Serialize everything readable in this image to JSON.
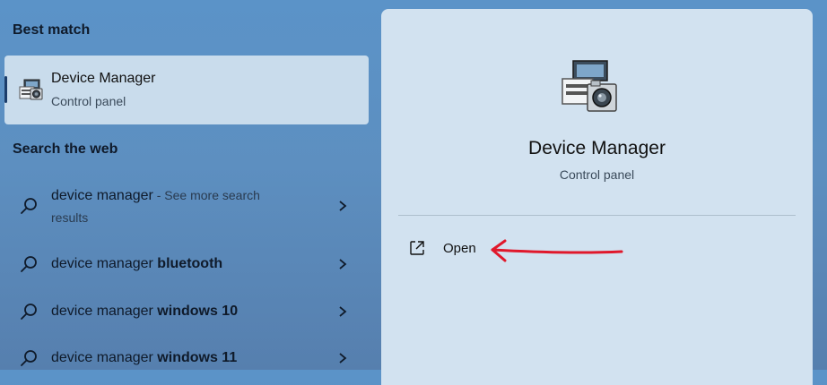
{
  "left": {
    "best_match_title": "Best match",
    "best_item": {
      "name": "Device Manager",
      "subtitle": "Control panel"
    },
    "search_web_title": "Search the web",
    "web_items": [
      {
        "query": "device manager",
        "bold": "",
        "hint": " - See more search",
        "hint2": "results"
      },
      {
        "query": "device manager ",
        "bold": "bluetooth"
      },
      {
        "query": "device manager ",
        "bold": "windows 10"
      },
      {
        "query": "device manager ",
        "bold": "windows 11"
      }
    ]
  },
  "right": {
    "name": "Device Manager",
    "subtitle": "Control panel",
    "open_label": "Open"
  },
  "colors": {
    "accent": "#1c3d6a",
    "annotation_arrow": "#e0182b"
  },
  "icons": [
    "device-manager-icon",
    "search-icon",
    "chevron-right-icon",
    "open-external-icon"
  ]
}
